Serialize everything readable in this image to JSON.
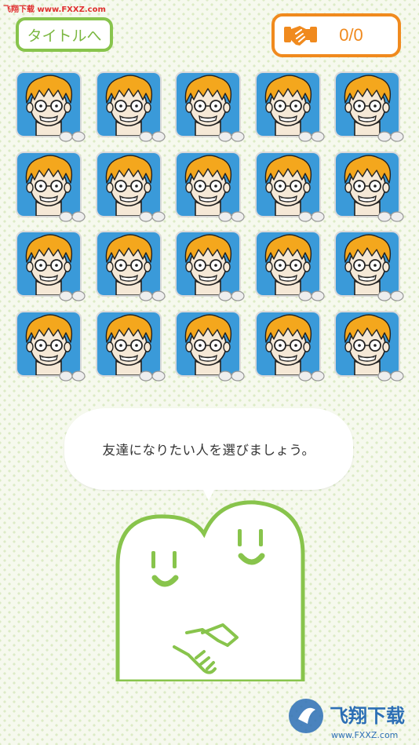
{
  "watermark": "飞翔下载 www.FXXZ.com",
  "header": {
    "title_button_label": "タイトルへ",
    "friend_count": "0/0",
    "friend_icon": "handshake-icon"
  },
  "grid": {
    "rows": 4,
    "columns": 5,
    "card_icon": "face-portrait-icon",
    "badge_icon": "glasses-icon"
  },
  "speech_bubble": {
    "text": "友達になりたい人を選びましょう。"
  },
  "mascot": {
    "icon": "smiling-friends-handshake-icon"
  },
  "footer_logo": {
    "text": "飞翔下载",
    "url_text": "www.FXXZ.com"
  },
  "colors": {
    "green": "#88c44c",
    "orange": "#f08a1e",
    "hair": "#f4a71d",
    "card_bg": "#3a9ad9"
  }
}
